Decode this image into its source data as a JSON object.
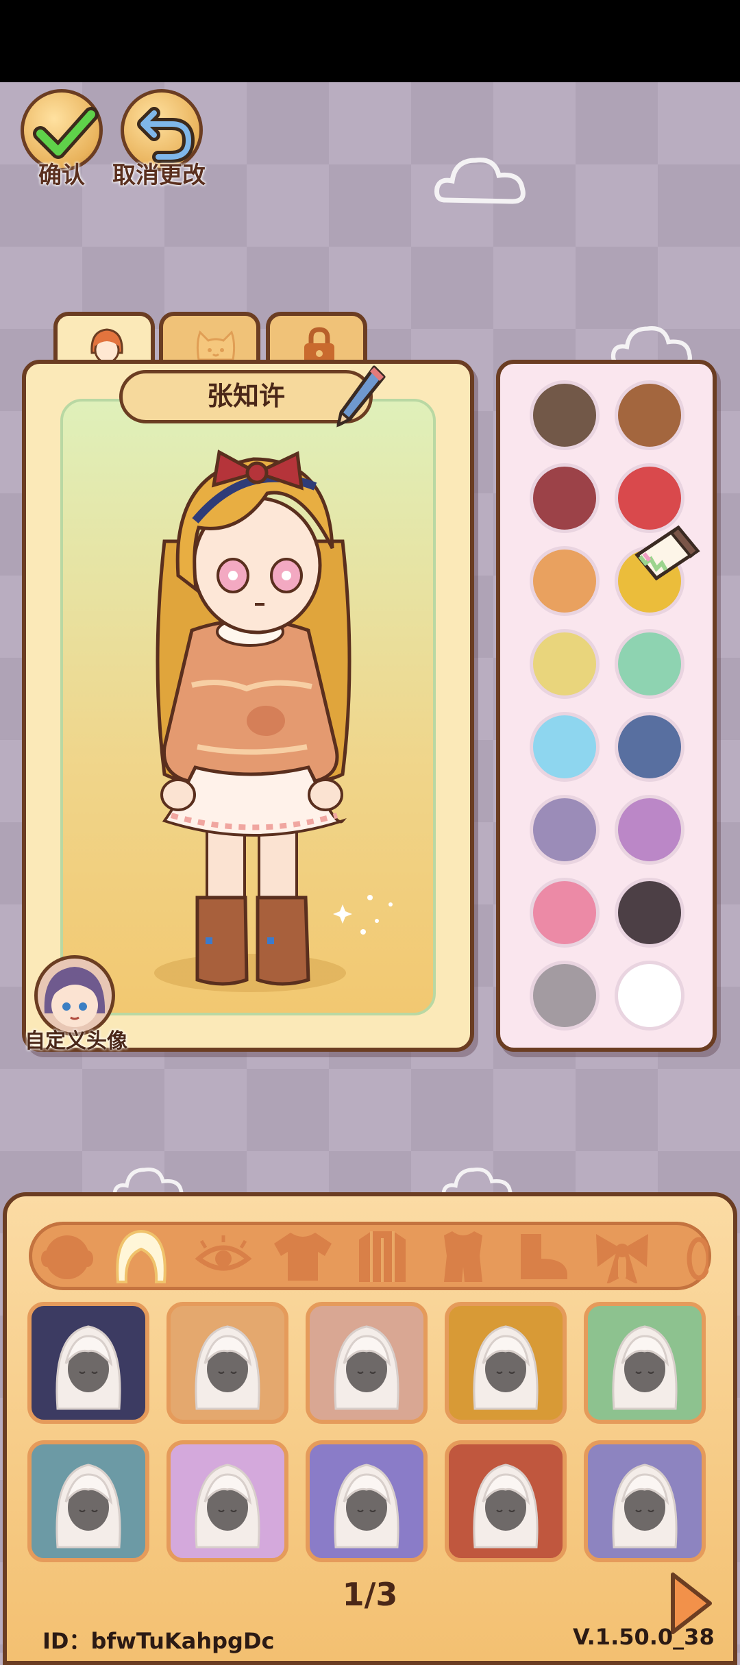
{
  "top_buttons": {
    "confirm_label": "确认",
    "cancel_label": "取消更改"
  },
  "tabs": [
    {
      "name": "character",
      "icon": "girl-face-icon",
      "active": true
    },
    {
      "name": "pet",
      "icon": "cat-face-icon",
      "active": false
    },
    {
      "name": "locked",
      "icon": "lock-icon",
      "active": false
    }
  ],
  "character": {
    "name": "张知许",
    "avatar_label": "自定义头像"
  },
  "palette": {
    "colors": [
      "#725848",
      "#a3663e",
      "#9c4248",
      "#d9494c",
      "#e9a15f",
      "#ebbd3b",
      "#e9d57c",
      "#8ed3b1",
      "#8ed6ef",
      "#586fa0",
      "#9b8cb8",
      "#bb87c7",
      "#ec8aa6",
      "#4c3f45",
      "#a39ba1",
      "#ffffff"
    ]
  },
  "categories": [
    {
      "name": "face",
      "icon": "face-icon"
    },
    {
      "name": "hair",
      "icon": "hair-icon",
      "active": true
    },
    {
      "name": "eyes",
      "icon": "eye-icon"
    },
    {
      "name": "top",
      "icon": "shirt-icon"
    },
    {
      "name": "coat",
      "icon": "coat-icon"
    },
    {
      "name": "outfit",
      "icon": "dress-icon"
    },
    {
      "name": "shoes",
      "icon": "shoe-icon"
    },
    {
      "name": "accessory",
      "icon": "bow-icon"
    },
    {
      "name": "more",
      "icon": "ring-icon"
    }
  ],
  "hair_items": [
    {
      "bg": "#3c3b62",
      "style": "short-messy"
    },
    {
      "bg": "#e4a86e",
      "style": "twin-braids"
    },
    {
      "bg": "#d9a793",
      "style": "cat-ears-long"
    },
    {
      "bg": "#d89a36",
      "style": "bun-ornament"
    },
    {
      "bg": "#8dc28f",
      "style": "side-braid"
    },
    {
      "bg": "#6c9aa5",
      "style": "side-curls"
    },
    {
      "bg": "#d4a9dc",
      "style": "high-bun-long"
    },
    {
      "bg": "#8a7cc8",
      "style": "long-straight"
    },
    {
      "bg": "#c0573e",
      "style": "short-wavy"
    },
    {
      "bg": "#8d84c0",
      "style": "braided-long"
    }
  ],
  "pagination": {
    "indicator": "1/3",
    "next_icon": "next-arrow-icon"
  },
  "footer": {
    "id_text": "ID：bfwTuKahpgDc",
    "version": "V.1.50.0_38"
  }
}
